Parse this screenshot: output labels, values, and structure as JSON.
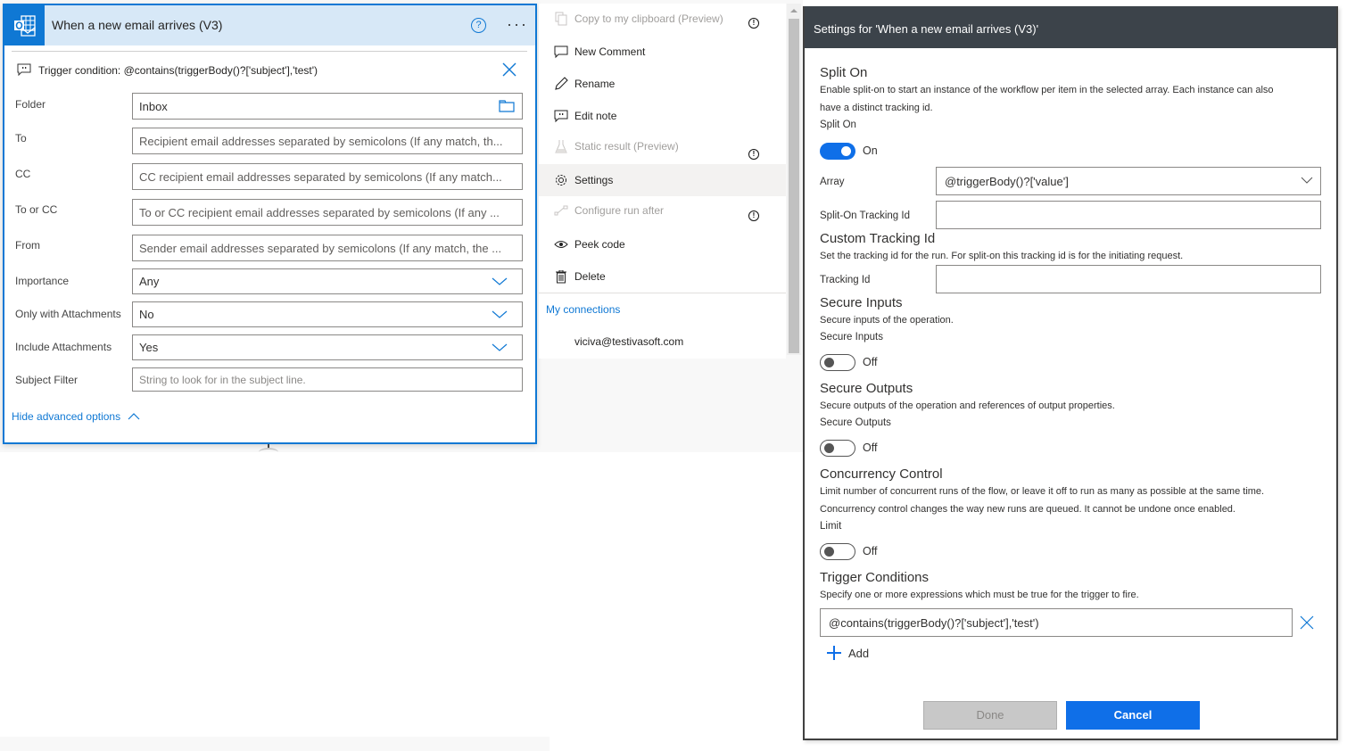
{
  "trigger_card": {
    "title": "When a new email arrives (V3)",
    "help_icon": "question-circle-icon",
    "more_icon": "ellipsis-icon",
    "trigger_condition": "Trigger condition: @contains(triggerBody()?['subject'],'test')",
    "fields": [
      {
        "label": "Folder",
        "value": "Inbox",
        "placeholder": "",
        "type": "folder-picker"
      },
      {
        "label": "To",
        "value": "",
        "placeholder": "Recipient email addresses separated by semicolons (If any match, th...",
        "type": "text"
      },
      {
        "label": "CC",
        "value": "",
        "placeholder": "CC recipient email addresses separated by semicolons (If any match...",
        "type": "text"
      },
      {
        "label": "To or CC",
        "value": "",
        "placeholder": "To or CC recipient email addresses separated by semicolons (If any ...",
        "type": "text"
      },
      {
        "label": "From",
        "value": "",
        "placeholder": "Sender email addresses separated by semicolons (If any match, the ...",
        "type": "text"
      },
      {
        "label": "Importance",
        "value": "Any",
        "placeholder": "",
        "type": "dropdown"
      },
      {
        "label": "Only with Attachments",
        "value": "No",
        "placeholder": "",
        "type": "dropdown"
      },
      {
        "label": "Include Attachments",
        "value": "Yes",
        "placeholder": "",
        "type": "dropdown"
      },
      {
        "label": "Subject Filter",
        "value": "",
        "placeholder": "String to look for in the subject line.",
        "type": "text"
      }
    ],
    "advanced_toggle": "Hide advanced options"
  },
  "context_menu": {
    "items": [
      {
        "label": "Copy to my clipboard (Preview)",
        "icon": "copy-icon",
        "disabled": true,
        "info": true
      },
      {
        "label": "New Comment",
        "icon": "comment-icon",
        "disabled": false,
        "info": false
      },
      {
        "label": "Rename",
        "icon": "pencil-icon",
        "disabled": false,
        "info": false
      },
      {
        "label": "Edit note",
        "icon": "note-icon",
        "disabled": false,
        "info": false
      },
      {
        "label": "Static result (Preview)",
        "icon": "flask-icon",
        "disabled": true,
        "info": true
      },
      {
        "label": "Settings",
        "icon": "gear-icon",
        "disabled": false,
        "info": false,
        "active": true
      },
      {
        "label": "Configure run after",
        "icon": "run-after-icon",
        "disabled": true,
        "info": true
      },
      {
        "label": "Peek code",
        "icon": "eye-icon",
        "disabled": false,
        "info": false
      },
      {
        "label": "Delete",
        "icon": "trash-icon",
        "disabled": false,
        "info": false
      }
    ],
    "connections_title": "My connections",
    "connection": "viciva@testivasoft.com"
  },
  "settings": {
    "title": "Settings for 'When a new email arrives (V3)'",
    "split_on": {
      "heading": "Split On",
      "desc_line1": "Enable split-on to start an instance of the workflow per item in the selected array. Each instance can also",
      "desc_line2": "have a distinct tracking id.",
      "label": "Split On",
      "state": "On",
      "array_label": "Array",
      "array_value": "@triggerBody()?['value']",
      "tracking_label": "Split-On Tracking Id",
      "tracking_value": ""
    },
    "custom_tracking": {
      "heading": "Custom Tracking Id",
      "desc": "Set the tracking id for the run. For split-on this tracking id is for the initiating request.",
      "label": "Tracking Id",
      "value": ""
    },
    "secure_inputs": {
      "heading": "Secure Inputs",
      "desc": "Secure inputs of the operation.",
      "label": "Secure Inputs",
      "state": "Off"
    },
    "secure_outputs": {
      "heading": "Secure Outputs",
      "desc": "Secure outputs of the operation and references of output properties.",
      "label": "Secure Outputs",
      "state": "Off"
    },
    "concurrency": {
      "heading": "Concurrency Control",
      "desc_line1": "Limit number of concurrent runs of the flow, or leave it off to run as many as possible at the same time.",
      "desc_line2": "Concurrency control changes the way new runs are queued. It cannot be undone once enabled.",
      "label": "Limit",
      "state": "Off"
    },
    "trigger_conditions": {
      "heading": "Trigger Conditions",
      "desc": "Specify one or more expressions which must be true for the trigger to fire.",
      "conditions": [
        "@contains(triggerBody()?['subject'],'test')"
      ],
      "add_label": "Add"
    },
    "buttons": {
      "done": "Done",
      "cancel": "Cancel"
    }
  },
  "colors": {
    "accent": "#0f78d4",
    "primary_button": "#0f6fe8",
    "settings_header": "#3c434a",
    "card_header": "#d7e8f7"
  }
}
